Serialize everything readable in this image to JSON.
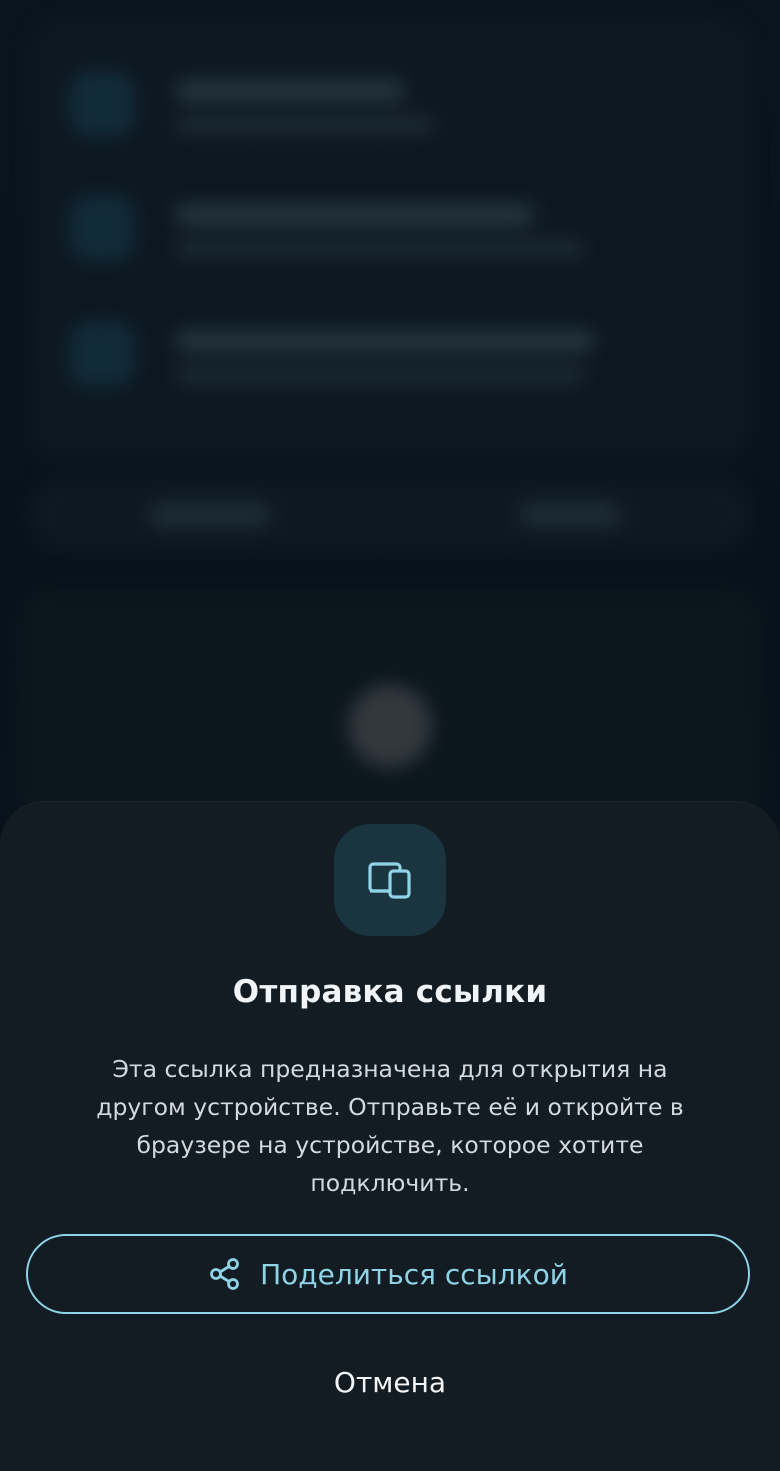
{
  "sheet": {
    "icon": "devices-icon",
    "title": "Отправка ссылки",
    "description": "Эта ссылка предназначена для открытия на другом устройстве. Отправьте её и откройте в браузере на устройстве, которое хотите подключить.",
    "share_button": {
      "icon": "share-icon",
      "label": "Поделиться ссылкой"
    },
    "cancel_label": "Отмена"
  },
  "colors": {
    "accent": "#8fd3e6",
    "sheet_background": "#131c23",
    "icon_tile": "#1b3540",
    "title_text": "#f2f5f7"
  }
}
